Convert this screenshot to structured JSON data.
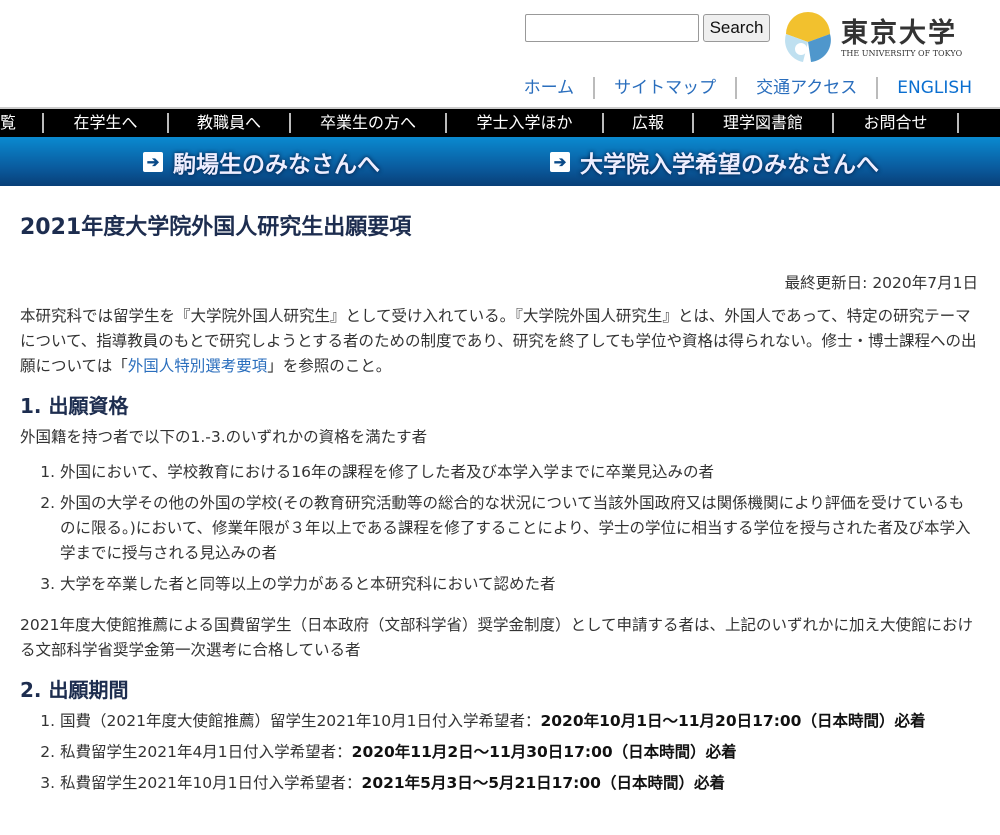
{
  "header": {
    "search_placeholder": "",
    "search_button": "Search",
    "logo_jp": "東京大学",
    "logo_en": "THE UNIVERSITY OF TOKYO",
    "links": [
      "ホーム",
      "サイトマップ",
      "交通アクセス",
      "ENGLISH"
    ]
  },
  "nav": [
    "覧",
    "在学生へ",
    "教職員へ",
    "卒業生の方へ",
    "学士入学ほか",
    "広報",
    "理学図書館",
    "お問合せ"
  ],
  "banners": [
    "駒場生のみなさんへ",
    "大学院入学希望のみなさんへ"
  ],
  "page": {
    "title": "2021年度大学院外国人研究生出願要項",
    "updated": "最終更新日: 2020年7月1日",
    "intro_before": "本研究科では留学生を『大学院外国人研究生』として受け入れている。『大学院外国人研究生』とは、外国人であって、特定の研究テーマについて、指導教員のもとで研究しようとする者のための制度であり、研究を終了しても学位や資格は得られない。修士・博士課程への出願については「",
    "intro_link": "外国人特別選考要項",
    "intro_after": "」を参照のこと。",
    "s1_title": "1. 出願資格",
    "s1_lead": "外国籍を持つ者で以下の1.-3.のいずれかの資格を満たす者",
    "s1_items": [
      "外国において、学校教育における16年の課程を修了した者及び本学入学までに卒業見込みの者",
      "外国の大学その他の外国の学校(その教育研究活動等の総合的な状況について当該外国政府又は関係機関により評価を受けているものに限る。)において、修業年限が３年以上である課程を修了することにより、学士の学位に相当する学位を授与された者及び本学入学までに授与される見込みの者",
      "大学を卒業した者と同等以上の学力があると本研究科において認めた者"
    ],
    "s1_note": "2021年度大使館推薦による国費留学生（日本政府（文部科学省）奨学金制度）として申請する者は、上記のいずれかに加え大使館における文部科学省奨学金第一次選考に合格している者",
    "s2_title": "2. 出願期間",
    "s2_items": [
      {
        "label": "国費（2021年度大使館推薦）留学生2021年10月1日付入学希望者：",
        "period": "2020年10月1日～11月20日17:00（日本時間）必着"
      },
      {
        "label": "私費留学生2021年4月1日付入学希望者：",
        "period": "2020年11月2日～11月30日17:00（日本時間）必着"
      },
      {
        "label": "私費留学生2021年10月1日付入学希望者：",
        "period": "2021年5月3日～5月21日17:00（日本時間）必着"
      }
    ]
  }
}
